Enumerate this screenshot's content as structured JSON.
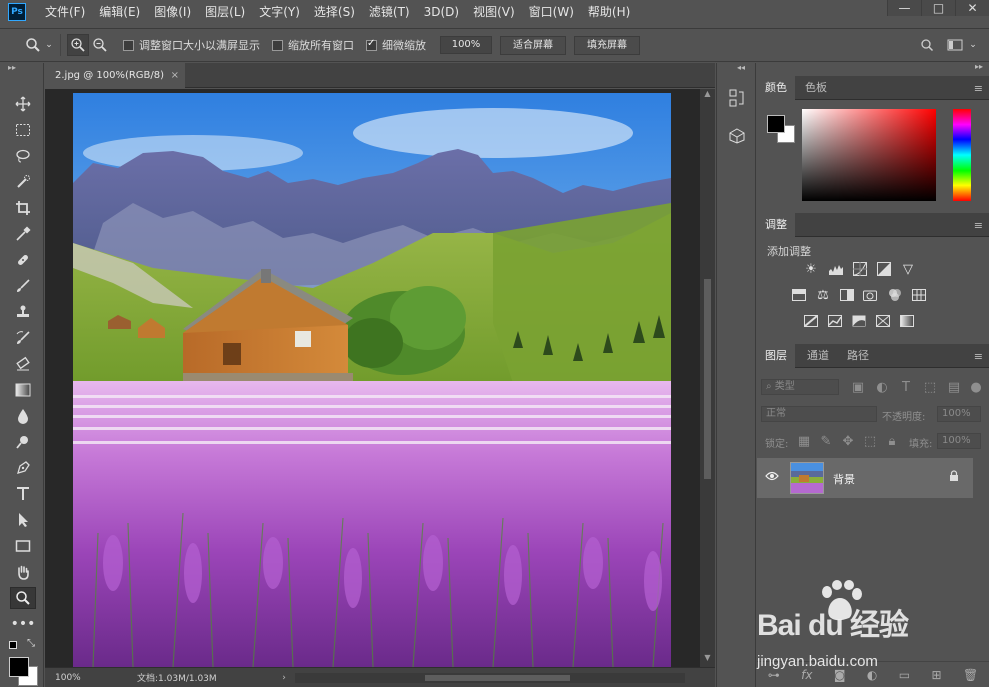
{
  "app": {
    "logo": "Ps"
  },
  "menu": [
    "文件(F)",
    "编辑(E)",
    "图像(I)",
    "图层(L)",
    "文字(Y)",
    "选择(S)",
    "滤镜(T)",
    "3D(D)",
    "视图(V)",
    "窗口(W)",
    "帮助(H)"
  ],
  "window_controls": {
    "minimize": "—",
    "maximize": "□",
    "close": "✕"
  },
  "options": {
    "resize_windows_label": "调整窗口大小以满屏显示",
    "resize_windows_checked": false,
    "zoom_all_label": "缩放所有窗口",
    "zoom_all_checked": false,
    "scrubby_zoom_label": "细微缩放",
    "scrubby_zoom_checked": true,
    "zoom_value": "100%",
    "fit_screen_label": "适合屏幕",
    "fill_screen_label": "填充屏幕"
  },
  "document": {
    "tab_title": "2.jpg @ 100%(RGB/8)",
    "close_glyph": "×"
  },
  "status": {
    "zoom": "100%",
    "doc_size": "文档:1.03M/1.03M",
    "arrow": "›"
  },
  "color_panel": {
    "tabs": [
      "颜色",
      "色板"
    ]
  },
  "adjust_panel": {
    "tab": "调整",
    "title": "添加调整"
  },
  "layers_panel": {
    "tabs": [
      "图层",
      "通道",
      "路径"
    ],
    "filter_label": "类型",
    "blend_mode": "正常",
    "opacity_label": "不透明度:",
    "opacity_value": "100%",
    "lock_label": "锁定:",
    "fill_label": "填充:",
    "fill_value": "100%",
    "layers": [
      {
        "name": "背景",
        "visible": true,
        "locked": true
      }
    ]
  },
  "watermark": {
    "brand": "Bai du 经验",
    "url": "jingyan.baidu.com"
  },
  "colors": {
    "ui_bg": "#535353",
    "canvas_bg": "#282828",
    "accent": "#31a8ff"
  }
}
